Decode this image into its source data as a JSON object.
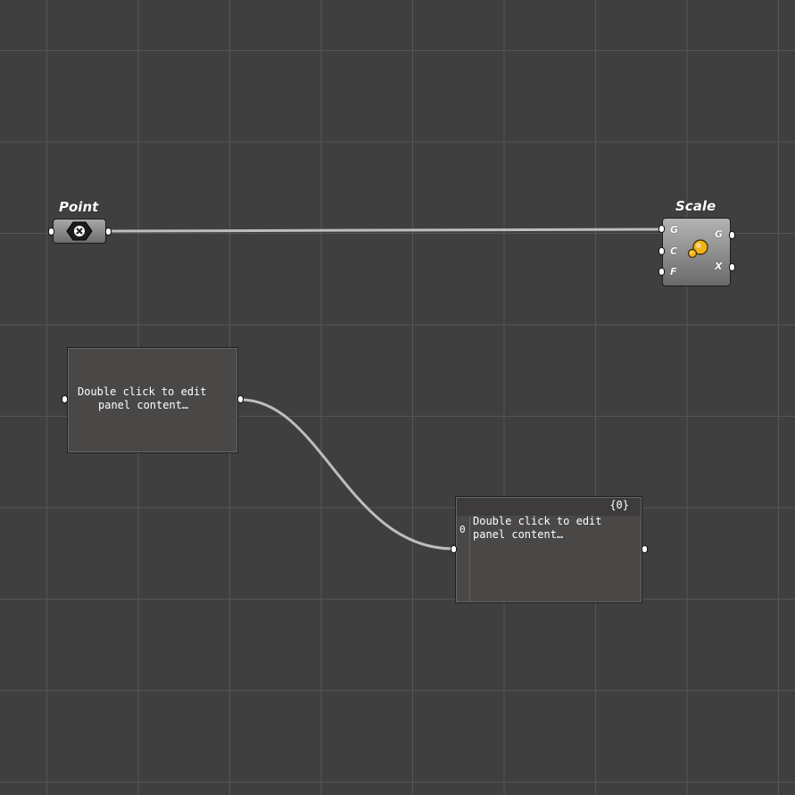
{
  "canvas": {
    "background": "#3f3f3f",
    "grid_color": "#555555",
    "wire_color": "#bdbdbd"
  },
  "point_component": {
    "title": "Point",
    "icon": "point-param-icon"
  },
  "scale_component": {
    "title": "Scale",
    "inputs": [
      "G",
      "C",
      "F"
    ],
    "outputs": [
      "G",
      "X"
    ],
    "icon": "scale-icon"
  },
  "panel_1": {
    "content_line1": "Double click to edit",
    "content_line2": "panel content…"
  },
  "panel_2": {
    "header": "{0}",
    "row_index": "0",
    "content_line1": "Double click to edit",
    "content_line2": "panel content…"
  }
}
